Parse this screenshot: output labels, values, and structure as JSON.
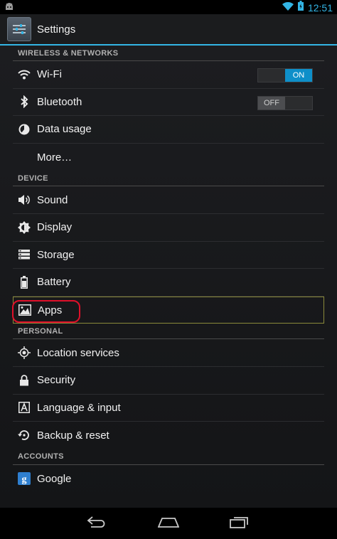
{
  "status_bar": {
    "time": "12:51"
  },
  "action_bar": {
    "title": "Settings"
  },
  "sections": {
    "wireless": {
      "header": "WIRELESS & NETWORKS",
      "wifi": {
        "label": "Wi-Fi",
        "toggle": "ON"
      },
      "bluetooth": {
        "label": "Bluetooth",
        "toggle": "OFF"
      },
      "data_usage": {
        "label": "Data usage"
      },
      "more": {
        "label": "More…"
      }
    },
    "device": {
      "header": "DEVICE",
      "sound": {
        "label": "Sound"
      },
      "display": {
        "label": "Display"
      },
      "storage": {
        "label": "Storage"
      },
      "battery": {
        "label": "Battery"
      },
      "apps": {
        "label": "Apps"
      }
    },
    "personal": {
      "header": "PERSONAL",
      "location": {
        "label": "Location services"
      },
      "security": {
        "label": "Security"
      },
      "language": {
        "label": "Language & input"
      },
      "backup": {
        "label": "Backup & reset"
      }
    },
    "accounts": {
      "header": "ACCOUNTS",
      "google": {
        "label": "Google"
      }
    }
  },
  "colors": {
    "accent": "#33b5e5",
    "toggle_on": "#0e8fc9",
    "annotation": "#e0102a"
  }
}
